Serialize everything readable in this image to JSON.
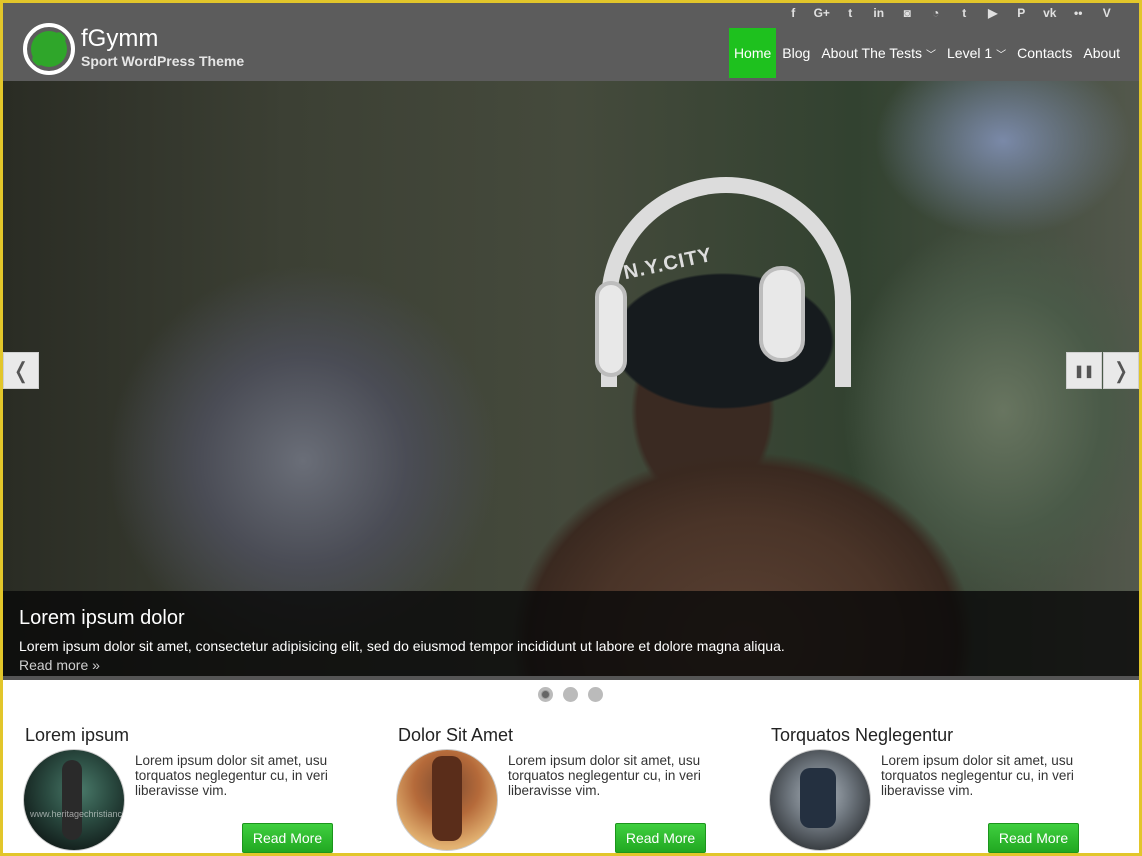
{
  "header": {
    "site_title": "fGymm",
    "tagline": "Sport WordPress Theme",
    "social_icons": [
      {
        "name": "facebook-icon",
        "glyph": "f"
      },
      {
        "name": "google-plus-icon",
        "glyph": "G+"
      },
      {
        "name": "twitter-icon",
        "glyph": "t"
      },
      {
        "name": "linkedin-icon",
        "glyph": "in"
      },
      {
        "name": "instagram-icon",
        "glyph": "◙"
      },
      {
        "name": "rss-icon",
        "glyph": "◔"
      },
      {
        "name": "tumblr-icon",
        "glyph": "t"
      },
      {
        "name": "youtube-icon",
        "glyph": "▶"
      },
      {
        "name": "pinterest-icon",
        "glyph": "P"
      },
      {
        "name": "vk-icon",
        "glyph": "vk"
      },
      {
        "name": "flickr-icon",
        "glyph": "••"
      },
      {
        "name": "vine-icon",
        "glyph": "V"
      }
    ],
    "nav": [
      {
        "label": "Home",
        "active": true,
        "has_submenu": false
      },
      {
        "label": "Blog",
        "active": false,
        "has_submenu": false
      },
      {
        "label": "About The Tests",
        "active": false,
        "has_submenu": true
      },
      {
        "label": "Level 1",
        "active": false,
        "has_submenu": true
      },
      {
        "label": "Contacts",
        "active": false,
        "has_submenu": false
      },
      {
        "label": "About",
        "active": false,
        "has_submenu": false
      }
    ],
    "accent_color": "#1ec11e"
  },
  "slider": {
    "cap_text": "N.Y.CITY",
    "prev_glyph": "❬",
    "next_glyph": "❭",
    "pause_glyph": "❚❚",
    "caption": {
      "title": "Lorem ipsum dolor",
      "text": "Lorem ipsum dolor sit amet, consectetur adipisicing elit, sed do eiusmod tempor incididunt ut labore et dolore magna aliqua.",
      "read_more": "Read more »"
    },
    "slides_count": 3,
    "active_slide": 1
  },
  "features": [
    {
      "title": "Lorem ipsum",
      "text": "Lorem ipsum dolor sit amet, usu torquatos neglegentur cu, in veri liberavisse vim.",
      "button": "Read More"
    },
    {
      "title": "Dolor Sit Amet",
      "text": "Lorem ipsum dolor sit amet, usu torquatos neglegentur cu, in veri liberavisse vim.",
      "button": "Read More"
    },
    {
      "title": "Torquatos Neglegentur",
      "text": "Lorem ipsum dolor sit amet, usu torquatos neglegentur cu, in veri liberavisse vim.",
      "button": "Read More"
    }
  ],
  "watermark": "www.heritagechristiancollege.com"
}
